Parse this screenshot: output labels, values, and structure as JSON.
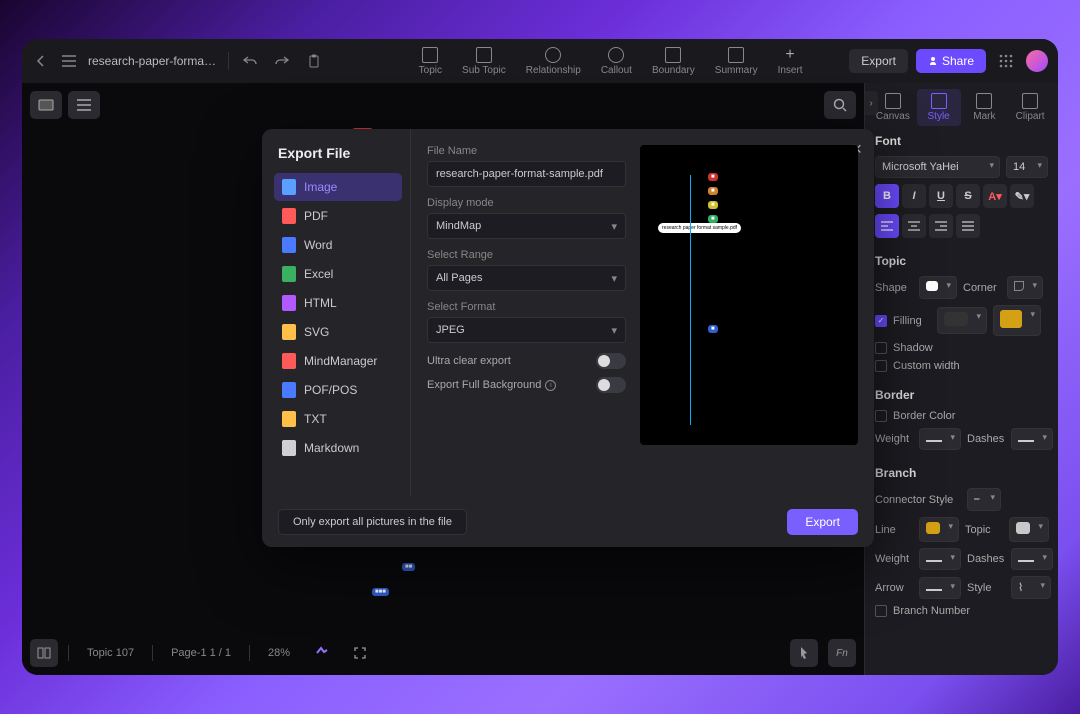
{
  "header": {
    "doc_title": "research-paper-format-sa...",
    "tools": [
      "Topic",
      "Sub Topic",
      "Relationship",
      "Callout",
      "Boundary",
      "Summary",
      "Insert"
    ],
    "export_btn": "Export",
    "share_btn": "Share"
  },
  "status": {
    "topic_count": "Topic 107",
    "page_info": "Page-1  1 / 1",
    "zoom": "28%"
  },
  "sidebar": {
    "tabs": [
      "Canvas",
      "Style",
      "Mark",
      "Clipart"
    ],
    "active_tab": 1,
    "font": {
      "title": "Font",
      "family": "Microsoft YaHei",
      "size": "14"
    },
    "topic": {
      "title": "Topic",
      "shape_label": "Shape",
      "corner_label": "Corner",
      "filling_label": "Filling",
      "filling_color": "#d4a015",
      "shadow_label": "Shadow",
      "custom_width_label": "Custom width"
    },
    "border": {
      "title": "Border",
      "color_label": "Border Color",
      "weight_label": "Weight",
      "dashes_label": "Dashes"
    },
    "branch": {
      "title": "Branch",
      "connector_label": "Connector Style",
      "line_label": "Line",
      "topic_label": "Topic",
      "line_color": "#d4a015",
      "topic_color": "#c8c8c8",
      "weight_label": "Weight",
      "dashes_label": "Dashes",
      "arrow_label": "Arrow",
      "style_label": "Style",
      "branch_number_label": "Branch Number"
    }
  },
  "modal": {
    "title": "Export File",
    "formats": [
      {
        "label": "Image",
        "color": "#5aa0ff"
      },
      {
        "label": "PDF",
        "color": "#ff5a5a"
      },
      {
        "label": "Word",
        "color": "#4a7aff"
      },
      {
        "label": "Excel",
        "color": "#3ab060"
      },
      {
        "label": "HTML",
        "color": "#b05aff"
      },
      {
        "label": "SVG",
        "color": "#ffc04a"
      },
      {
        "label": "MindManager",
        "color": "#ff5a5a"
      },
      {
        "label": "POF/POS",
        "color": "#4a7aff"
      },
      {
        "label": "TXT",
        "color": "#ffc04a"
      },
      {
        "label": "Markdown",
        "color": "#d0d0d0"
      }
    ],
    "active_format": 0,
    "fields": {
      "file_name_label": "File Name",
      "file_name_value": "research-paper-format-sample.pdf",
      "display_mode_label": "Display mode",
      "display_mode_value": "MindMap",
      "select_range_label": "Select Range",
      "select_range_value": "All Pages",
      "select_format_label": "Select Format",
      "select_format_value": "JPEG",
      "ultra_clear_label": "Ultra clear export",
      "export_full_bg_label": "Export Full Background"
    },
    "footer": {
      "only_pictures": "Only export all pictures in the file",
      "export": "Export"
    }
  }
}
